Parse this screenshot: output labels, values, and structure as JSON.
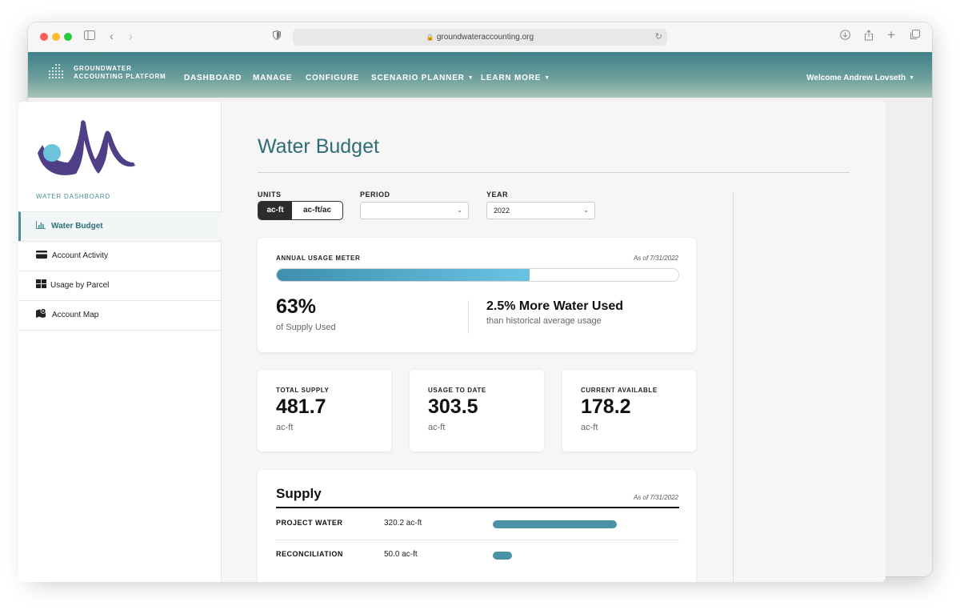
{
  "browser": {
    "url": "groundwateraccounting.org"
  },
  "nav": {
    "brand_line1": "GROUNDWATER",
    "brand_line2": "ACCOUNTING PLATFORM",
    "items": [
      "DASHBOARD",
      "MANAGE",
      "CONFIGURE",
      "SCENARIO PLANNER",
      "LEARN MORE"
    ],
    "welcome": "Welcome Andrew Lovseth"
  },
  "sidebar": {
    "section_label": "WATER DASHBOARD",
    "items": [
      {
        "label": "Water Budget",
        "icon": "bar-chart-icon",
        "active": true
      },
      {
        "label": "Account Activity",
        "icon": "credit-card-icon",
        "active": false
      },
      {
        "label": "Usage by Parcel",
        "icon": "grid-icon",
        "active": false
      },
      {
        "label": "Account Map",
        "icon": "map-icon",
        "active": false
      }
    ]
  },
  "main": {
    "title": "Water Budget",
    "filters": {
      "units_label": "UNITS",
      "units_options": [
        "ac-ft",
        "ac-ft/ac"
      ],
      "units_selected": "ac-ft",
      "period_label": "PERIOD",
      "period_value": "",
      "year_label": "YEAR",
      "year_value": "2022"
    },
    "meter": {
      "title": "ANNUAL USAGE METER",
      "as_of": "As of 7/31/2022",
      "percent": 63,
      "percent_text": "63%",
      "percent_sub": "of Supply Used",
      "comparison": "2.5% More Water Used",
      "comparison_sub": "than historical average usage"
    },
    "stats": [
      {
        "label": "TOTAL SUPPLY",
        "value": "481.7",
        "unit": "ac-ft"
      },
      {
        "label": "USAGE TO DATE",
        "value": "303.5",
        "unit": "ac-ft"
      },
      {
        "label": "CURRENT AVAILABLE",
        "value": "178.2",
        "unit": "ac-ft"
      }
    ],
    "supply": {
      "title": "Supply",
      "as_of": "As of 7/31/2022",
      "rows": [
        {
          "label": "PROJECT WATER",
          "value": "320.2 ac-ft",
          "amount": 320.2
        },
        {
          "label": "RECONCILIATION",
          "value": "50.0 ac-ft",
          "amount": 50.0
        }
      ]
    }
  },
  "colors": {
    "accent": "#2f6c78",
    "meter_fill": "#5ab3d6",
    "supply_bar": "#4a92a6",
    "logo_purple": "#4e3f86",
    "logo_circle": "#6cc4dc"
  }
}
